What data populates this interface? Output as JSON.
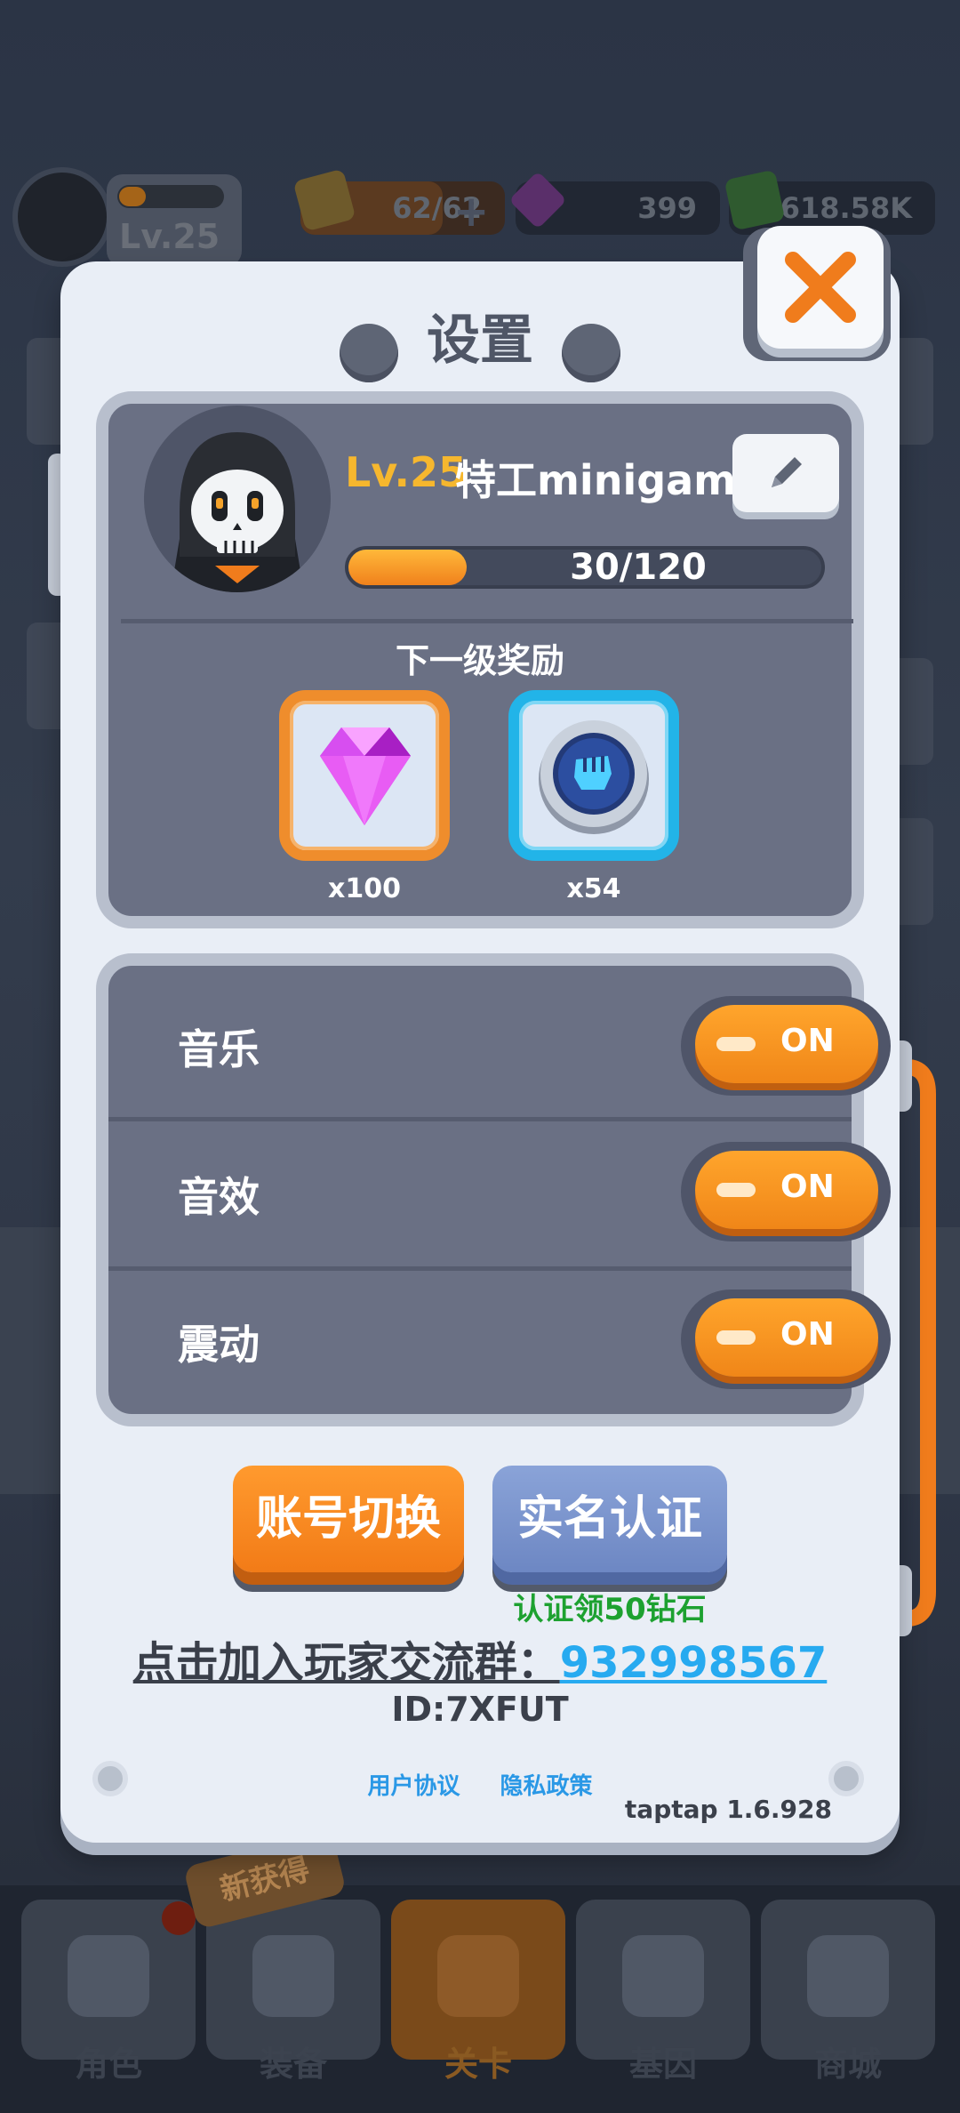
{
  "hud": {
    "level": "Lv.25",
    "energy": "62/62",
    "gems": "399",
    "cash": "618.58K"
  },
  "dialog": {
    "title": "设置",
    "profile": {
      "level": "Lv.25",
      "name": "特工minigam",
      "xp_text": "30/120",
      "xp_progress": 0.25,
      "next_reward_title": "下一级奖励",
      "rewards": [
        {
          "icon": "gem-icon",
          "count": "x100"
        },
        {
          "icon": "fist-coin-icon",
          "count": "x54"
        }
      ]
    },
    "settings": [
      {
        "label": "音乐",
        "state": "ON"
      },
      {
        "label": "音效",
        "state": "ON"
      },
      {
        "label": "震动",
        "state": "ON"
      }
    ],
    "buttons": {
      "switch_account": "账号切换",
      "verify": "实名认证",
      "verify_note": "认证领50钻石"
    },
    "group": {
      "label": "点击加入玩家交流群：",
      "number": "932998567"
    },
    "player_id": "ID:7XFUT",
    "links": {
      "user_agreement": "用户协议",
      "privacy": "隐私政策"
    },
    "version": "taptap 1.6.928"
  },
  "bottom_nav": {
    "new_badge": "新获得",
    "items": [
      {
        "label": "角色",
        "icon": "character-icon"
      },
      {
        "label": "装备",
        "icon": "equipment-icon"
      },
      {
        "label": "关卡",
        "icon": "map-pin-icon",
        "active": true
      },
      {
        "label": "基因",
        "icon": "gene-icon"
      },
      {
        "label": "商城",
        "icon": "shop-icon"
      }
    ]
  },
  "colors": {
    "accent_orange": "#f08618",
    "level_gold": "#f6b72e",
    "link_blue": "#27aaf0",
    "note_green": "#1da130"
  }
}
